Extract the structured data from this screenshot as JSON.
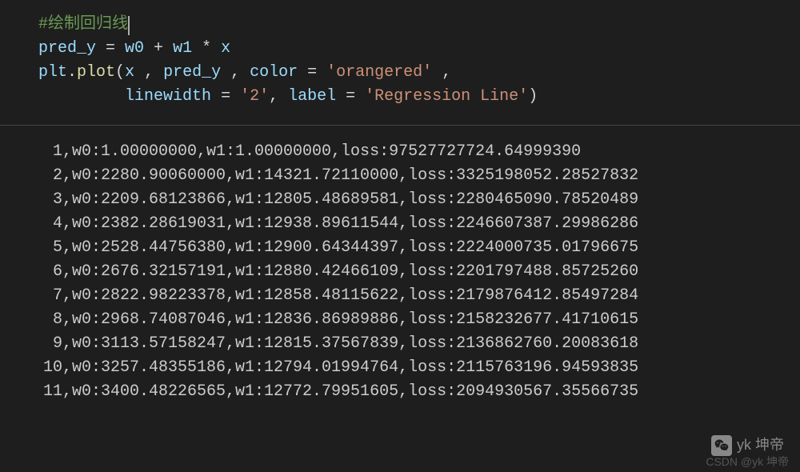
{
  "code": {
    "comment": "#绘制回归线",
    "line2": {
      "var": "pred_y",
      "eq": " = ",
      "w0": "w0",
      "plus": " + ",
      "w1": "w1",
      "mul": " * ",
      "x": "x"
    },
    "line3": {
      "obj": "plt",
      "dot": ".",
      "fn": "plot",
      "open": "(",
      "arg1": "x",
      "sep1": " , ",
      "arg2": "pred_y",
      "sep2": " , ",
      "kw1": "color",
      "eq1": " = ",
      "val1": "'orangered'",
      "sep3": " ,"
    },
    "line4": {
      "indent": "         ",
      "kw1": "linewidth",
      "eq1": " = ",
      "val1": "'2'",
      "sep1": ", ",
      "kw2": "label",
      "eq2": " = ",
      "val2": "'Regression Line'",
      "close": ")"
    }
  },
  "output": [
    {
      "n": "1",
      "rest": ",w0:1.00000000,w1:1.00000000,loss:97527727724.64999390"
    },
    {
      "n": "2",
      "rest": ",w0:2280.90060000,w1:14321.72110000,loss:3325198052.28527832"
    },
    {
      "n": "3",
      "rest": ",w0:2209.68123866,w1:12805.48689581,loss:2280465090.78520489"
    },
    {
      "n": "4",
      "rest": ",w0:2382.28619031,w1:12938.89611544,loss:2246607387.29986286"
    },
    {
      "n": "5",
      "rest": ",w0:2528.44756380,w1:12900.64344397,loss:2224000735.01796675"
    },
    {
      "n": "6",
      "rest": ",w0:2676.32157191,w1:12880.42466109,loss:2201797488.85725260"
    },
    {
      "n": "7",
      "rest": ",w0:2822.98223378,w1:12858.48115622,loss:2179876412.85497284"
    },
    {
      "n": "8",
      "rest": ",w0:2968.74087046,w1:12836.86989886,loss:2158232677.41710615"
    },
    {
      "n": "9",
      "rest": ",w0:3113.57158247,w1:12815.37567839,loss:2136862760.20083618"
    },
    {
      "n": "10",
      "rest": ",w0:3257.48355186,w1:12794.01994764,loss:2115763196.94593835"
    },
    {
      "n": "11",
      "rest": ",w0:3400.48226565,w1:12772.79951605,loss:2094930567.35566735"
    }
  ],
  "watermark": {
    "main": "yk 坤帝",
    "sub": "CSDN @yk 坤帝"
  }
}
